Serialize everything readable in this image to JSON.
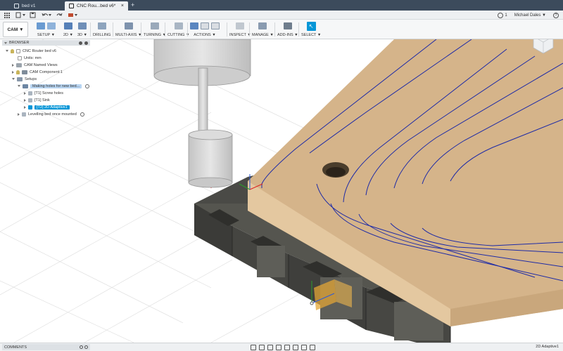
{
  "tabs": [
    {
      "label": "bed v1",
      "close": "×"
    },
    {
      "label": "CNC Rou...bed v6*",
      "close": "×"
    }
  ],
  "tab_add": "+",
  "quick": {
    "badge": "1",
    "user": "Michael Dales ▼",
    "help": "?"
  },
  "toolbar": {
    "workspace": "CAM ▼",
    "groups": [
      "SETUP ▼",
      "2D ▼",
      "3D ▼",
      "DRILLING",
      "MULTI-AXIS ▼",
      "TURNING ▼",
      "CUTTING ▼",
      "ACTIONS ▼",
      "INSPECT ▼",
      "MANAGE ▼",
      "ADD-INS ▼",
      "SELECT ▼"
    ]
  },
  "browser": {
    "title": "BROWSER",
    "items": [
      {
        "label": "CNC Router bed v6"
      },
      {
        "label": "Units: mm"
      },
      {
        "label": "CAM Named Views"
      },
      {
        "label": "CAM Component:1"
      },
      {
        "label": "Setups"
      },
      {
        "label": "Making holes for new bed..."
      },
      {
        "label": "[T1] Screw holes"
      },
      {
        "label": "[T1] Sink"
      },
      {
        "label": "[T2] 2D Adaptive1"
      },
      {
        "label": "Levelling bed once mounted"
      }
    ]
  },
  "comments": {
    "title": "COMMENTS"
  },
  "status": {
    "label": "2D Adaptive1"
  },
  "colors": {
    "tabbar": "#3c4b5c",
    "accent": "#0696d7",
    "wood": "#d6b58c",
    "frame": "#4b4b47",
    "toolpath": "#1d2aa6"
  }
}
